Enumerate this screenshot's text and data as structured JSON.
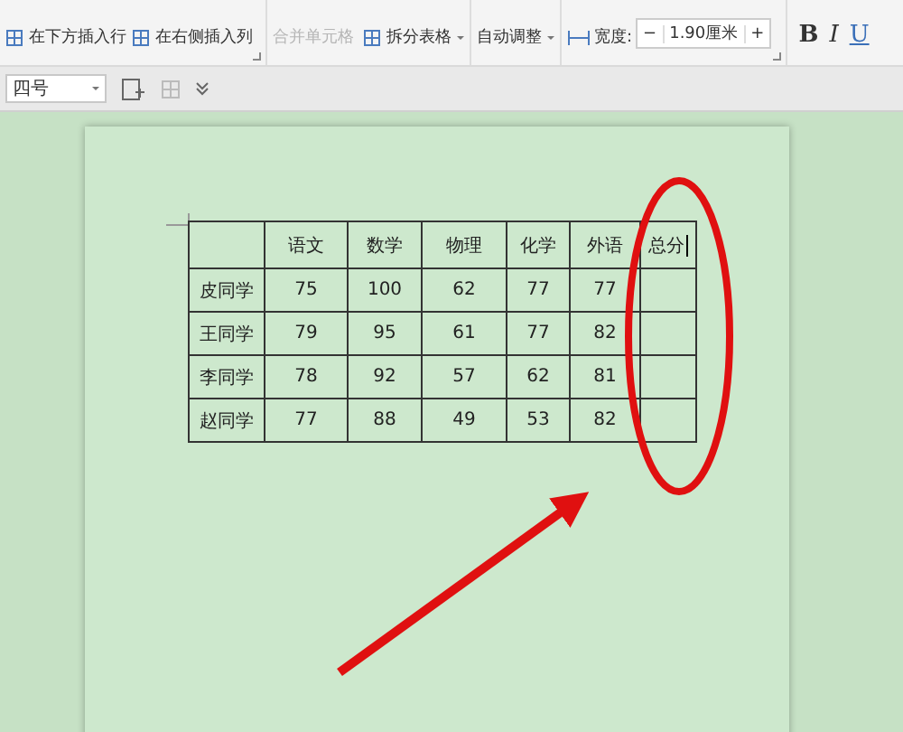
{
  "ribbon": {
    "insert_buttons": [
      {
        "label": "在下方插入行"
      },
      {
        "label": "在右侧插入列"
      }
    ],
    "merge_cells": {
      "label": "合并单元格",
      "disabled": true
    },
    "split_buttons": [
      {
        "label": "拆分表格",
        "dropdown": true
      }
    ],
    "auto_fit": {
      "label": "自动调整"
    },
    "size_fields": [
      {
        "label": "宽度:",
        "value": "1.90厘米",
        "minus": "−",
        "plus": "+"
      }
    ],
    "format_buttons": [
      {
        "label": "B",
        "kind": "bold"
      },
      {
        "label": "I",
        "kind": "italic"
      },
      {
        "label": "U",
        "kind": "underline"
      }
    ]
  },
  "toolbar": {
    "font_size": "四号"
  },
  "table": {
    "columns": [
      {
        "label": "语文",
        "has_caret": false
      },
      {
        "label": "数学",
        "has_caret": false
      },
      {
        "label": "物理",
        "has_caret": false
      },
      {
        "label": "化学",
        "has_caret": false
      },
      {
        "label": "外语",
        "has_caret": false
      },
      {
        "label": "总分",
        "has_caret": true
      }
    ],
    "rows": [
      {
        "name": "皮同学",
        "cells": [
          "75",
          "100",
          "62",
          "77",
          "77"
        ]
      },
      {
        "name": "王同学",
        "cells": [
          "79",
          "95",
          "61",
          "77",
          "82"
        ]
      },
      {
        "name": "李同学",
        "cells": [
          "78",
          "92",
          "57",
          "62",
          "81"
        ]
      },
      {
        "name": "赵同学",
        "cells": [
          "77",
          "88",
          "49",
          "53",
          "82"
        ]
      }
    ]
  }
}
